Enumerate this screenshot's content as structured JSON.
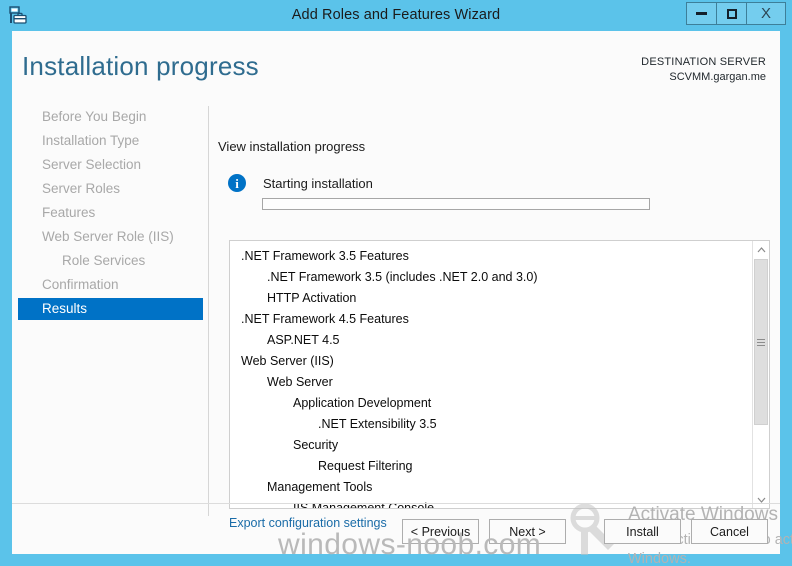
{
  "window": {
    "title": "Add Roles and Features Wizard",
    "icon": "server-roles-icon",
    "controls": {
      "minimize": "minimize-icon",
      "maximize": "maximize-icon",
      "close": "X"
    },
    "accent_color": "#5bc3ea",
    "selected_color": "#0072c6"
  },
  "header": {
    "page_title": "Installation progress",
    "destination_label": "DESTINATION SERVER",
    "destination_server": "SCVMM.gargan.me"
  },
  "sidebar": {
    "items": [
      {
        "label": "Before You Begin",
        "indent": 0,
        "selected": false
      },
      {
        "label": "Installation Type",
        "indent": 0,
        "selected": false
      },
      {
        "label": "Server Selection",
        "indent": 0,
        "selected": false
      },
      {
        "label": "Server Roles",
        "indent": 0,
        "selected": false
      },
      {
        "label": "Features",
        "indent": 0,
        "selected": false
      },
      {
        "label": "Web Server Role (IIS)",
        "indent": 0,
        "selected": false
      },
      {
        "label": "Role Services",
        "indent": 1,
        "selected": false
      },
      {
        "label": "Confirmation",
        "indent": 0,
        "selected": false
      },
      {
        "label": "Results",
        "indent": 0,
        "selected": true
      }
    ]
  },
  "main": {
    "section_label": "View installation progress",
    "status_text": "Starting installation",
    "info_icon_glyph": "i",
    "progress_percent": 0,
    "export_link": "Export configuration settings",
    "installed_items": [
      {
        "label": ".NET Framework 3.5 Features",
        "level": 0
      },
      {
        "label": ".NET Framework 3.5 (includes .NET 2.0 and 3.0)",
        "level": 1
      },
      {
        "label": "HTTP Activation",
        "level": 1
      },
      {
        "label": ".NET Framework 4.5 Features",
        "level": 0
      },
      {
        "label": "ASP.NET 4.5",
        "level": 1
      },
      {
        "label": "Web Server (IIS)",
        "level": 0
      },
      {
        "label": "Web Server",
        "level": 1
      },
      {
        "label": "Application Development",
        "level": 2
      },
      {
        "label": ".NET Extensibility 3.5",
        "level": 3
      },
      {
        "label": "Security",
        "level": 2
      },
      {
        "label": "Request Filtering",
        "level": 3
      },
      {
        "label": "Management Tools",
        "level": 1
      },
      {
        "label": "IIS Management Console",
        "level": 2
      }
    ]
  },
  "footer": {
    "previous": "< Previous",
    "next": "Next >",
    "install": "Install",
    "cancel": "Cancel"
  },
  "watermarks": {
    "activate_title": "Activate Windows",
    "activate_subtitle": "Go to Action Center to activate Windows.",
    "site": "windows-noob.com"
  }
}
